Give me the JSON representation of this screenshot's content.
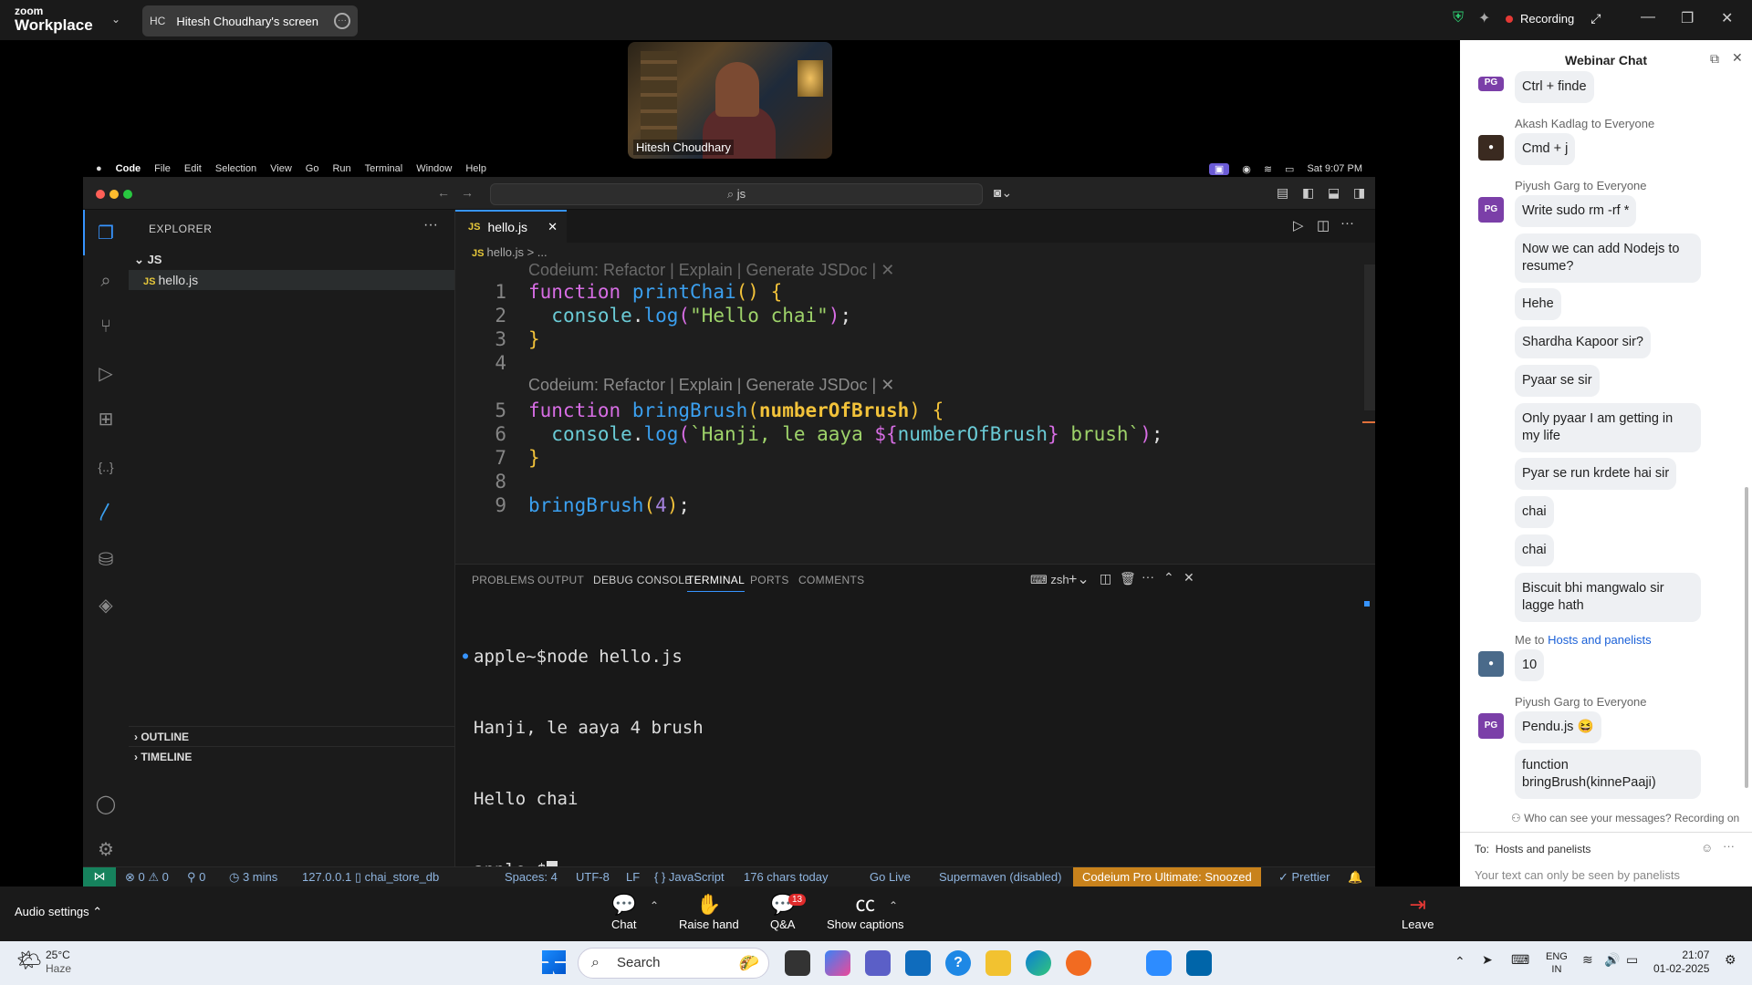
{
  "zoom": {
    "logo_top": "zoom",
    "logo_bottom": "Workplace",
    "share_initials": "HC",
    "share_label": "Hitesh Choudhary's screen",
    "recording": "Recording",
    "speaker_name": "Hitesh Choudhary"
  },
  "mac_menu": {
    "app": "Code",
    "items": [
      "File",
      "Edit",
      "Selection",
      "View",
      "Go",
      "Run",
      "Terminal",
      "Window",
      "Help"
    ],
    "clock": "Sat 9:07 PM"
  },
  "vscode": {
    "search": "js",
    "explorer_title": "EXPLORER",
    "folder": "JS",
    "file": "hello.js",
    "tab": "hello.js",
    "breadcrumb": "hello.js > ...",
    "codelens": "Codeium: Refactor | Explain | Generate JSDoc | ✕",
    "outline": "OUTLINE",
    "timeline": "TIMELINE",
    "panel_tabs": [
      "PROBLEMS",
      "OUTPUT",
      "DEBUG CONSOLE",
      "TERMINAL",
      "PORTS",
      "COMMENTS"
    ],
    "shell": "zsh",
    "terminal_lines": [
      "apple~$node hello.js",
      "Hanji, le aaya 4 brush",
      "Hello chai",
      "apple~$"
    ],
    "status": {
      "problems": "⊗ 0 ⚠ 0",
      "ports": "⚲ 0",
      "time": "◷ 3 mins",
      "db": "127.0.0.1 ▯ chai_store_db",
      "spaces": "Spaces: 4",
      "encoding": "UTF-8",
      "eol": "LF",
      "lang": "{ } JavaScript",
      "chars": "176 chars today",
      "golive": "Go Live",
      "supermaven": "Supermaven (disabled)",
      "codeium": "Codeium Pro Ultimate: Snoozed",
      "prettier": "✓ Prettier"
    }
  },
  "chat": {
    "title": "Webinar Chat",
    "messages": [
      {
        "sender": "",
        "text": "Ctrl + finde"
      },
      {
        "sender": "Akash Kadlag to Everyone",
        "text": "Cmd + j"
      },
      {
        "sender": "Piyush Garg to Everyone",
        "text": "Write sudo rm -rf *"
      },
      {
        "sender": "",
        "text": "Now we can add Nodejs to resume?"
      },
      {
        "sender": "",
        "text": "Hehe"
      },
      {
        "sender": "",
        "text": "Shardha Kapoor sir?"
      },
      {
        "sender": "",
        "text": "Pyaar se sir"
      },
      {
        "sender": "",
        "text": "Only pyaar I am getting in my life"
      },
      {
        "sender": "",
        "text": "Pyar se run krdete hai sir"
      },
      {
        "sender": "",
        "text": "chai"
      },
      {
        "sender": "",
        "text": "chai"
      },
      {
        "sender": "",
        "text": "Biscuit bhi mangwalo sir lagge hath"
      },
      {
        "sender": "Me to",
        "sender_to": "Hosts and panelists",
        "text": "10"
      },
      {
        "sender": "Piyush Garg to Everyone",
        "text": "Pendu.js 😆"
      },
      {
        "sender": "",
        "text": "function bringBrush(kinnePaaji)"
      }
    ],
    "avatar_initials": "PG",
    "visibility_note": "Who can see your messages? Recording on",
    "to_label": "To:",
    "to_value": "Hosts and panelists",
    "input_placeholder": "Your text can only be seen by panelists"
  },
  "controls": {
    "audio": "Audio settings",
    "chat": "Chat",
    "raise": "Raise hand",
    "qa": "Q&A",
    "qa_badge": "13",
    "captions": "Show captions",
    "leave": "Leave"
  },
  "taskbar": {
    "temp": "25°C",
    "weather": "Haze",
    "search": "Search",
    "lang_top": "ENG",
    "lang_bottom": "IN",
    "time": "21:07",
    "date": "01-02-2025"
  }
}
